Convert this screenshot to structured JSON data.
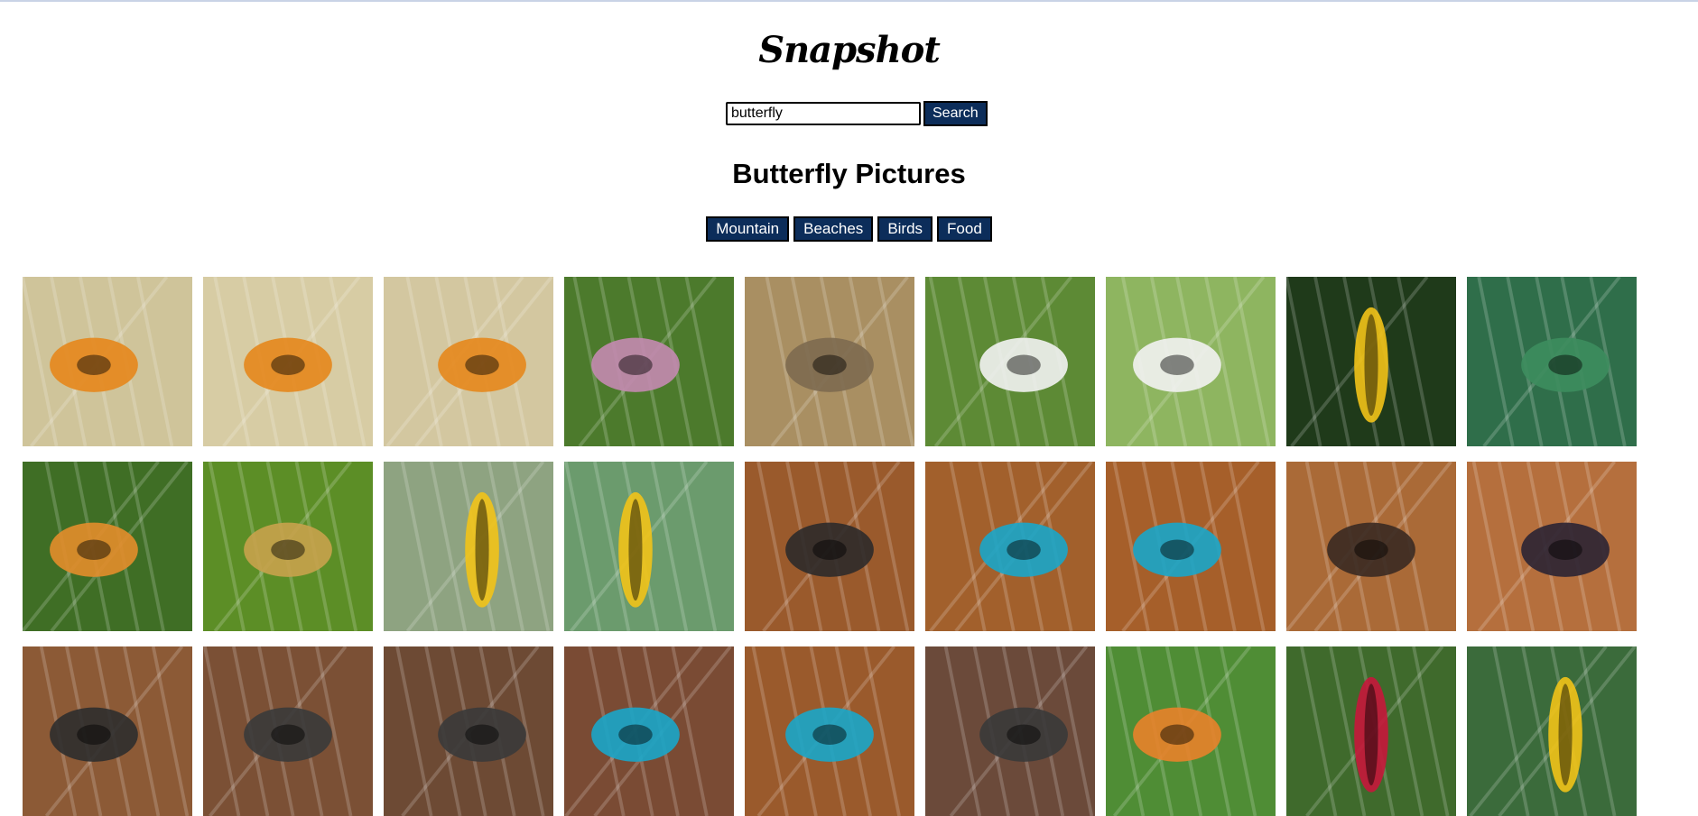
{
  "app": {
    "logo": "Snapshot",
    "page_title": "Butterfly Pictures"
  },
  "search": {
    "value": "butterfly",
    "placeholder": "Search...",
    "button_label": "Search"
  },
  "categories": [
    "Mountain",
    "Beaches",
    "Birds",
    "Food"
  ],
  "photos": [
    {
      "subject": "gulf-fritillary-butterfly",
      "bg": "#cfc49a",
      "accent": "#e5871c"
    },
    {
      "subject": "gulf-fritillary-butterfly",
      "bg": "#d7cca4",
      "accent": "#e5871c"
    },
    {
      "subject": "gulf-fritillary-butterfly",
      "bg": "#d3c7a0",
      "accent": "#e5871c"
    },
    {
      "subject": "butterfly-on-pink-flower",
      "bg": "#4c7a2c",
      "accent": "#c48ab0"
    },
    {
      "subject": "curve-billed-thrasher-bird",
      "bg": "#a98f62",
      "accent": "#7d6a50"
    },
    {
      "subject": "marbled-white-butterfly",
      "bg": "#5d8a35",
      "accent": "#f2f2f2"
    },
    {
      "subject": "marbled-white-butterfly",
      "bg": "#8eb560",
      "accent": "#f2f2f2"
    },
    {
      "subject": "monarch-caterpillar",
      "bg": "#1f3a1a",
      "accent": "#f2c318"
    },
    {
      "subject": "green-leaves",
      "bg": "#2f6e4a",
      "accent": "#3d8d5e"
    },
    {
      "subject": "orange-butterfly-on-flowers",
      "bg": "#3f6e25",
      "accent": "#e38d2b"
    },
    {
      "subject": "hairstreak-butterfly",
      "bg": "#5c8e26",
      "accent": "#c8a24d"
    },
    {
      "subject": "monarch-caterpillar",
      "bg": "#8ea381",
      "accent": "#f2c318"
    },
    {
      "subject": "monarch-caterpillar",
      "bg": "#6b9b6d",
      "accent": "#f2c318"
    },
    {
      "subject": "dark-butterfly-on-leaf",
      "bg": "#9a5a2c",
      "accent": "#2e2a2a"
    },
    {
      "subject": "blue-butterfly-on-leaf",
      "bg": "#a2602c",
      "accent": "#1aa6c9"
    },
    {
      "subject": "blue-butterfly-on-leaf",
      "bg": "#a65f2a",
      "accent": "#1aa6c9"
    },
    {
      "subject": "dark-butterfly-on-leaf",
      "bg": "#aa6a37",
      "accent": "#3a2a22"
    },
    {
      "subject": "dark-butterfly-on-leaf",
      "bg": "#b56f3d",
      "accent": "#2b2433"
    },
    {
      "subject": "butterfly-on-ground",
      "bg": "#8c5a36",
      "accent": "#2e2e2e"
    },
    {
      "subject": "butterfly-on-ground",
      "bg": "#7b5035",
      "accent": "#3a3a3a"
    },
    {
      "subject": "butterfly-on-ground",
      "bg": "#6d4a34",
      "accent": "#3a3a3a"
    },
    {
      "subject": "blue-butterfly-closeup",
      "bg": "#7a4b34",
      "accent": "#1aa6c9"
    },
    {
      "subject": "blue-butterfly-closeup",
      "bg": "#9a5a2c",
      "accent": "#1aa6c9"
    },
    {
      "subject": "butterfly-on-ground",
      "bg": "#6b4a3a",
      "accent": "#3a3a3a"
    },
    {
      "subject": "comma-butterfly-on-leaves",
      "bg": "#4f8d35",
      "accent": "#e8822a"
    },
    {
      "subject": "caterpillar-red-flowers",
      "bg": "#3f6a2c",
      "accent": "#c7173b"
    },
    {
      "subject": "monarch-caterpillar",
      "bg": "#3b6b3b",
      "accent": "#f2c318"
    }
  ]
}
